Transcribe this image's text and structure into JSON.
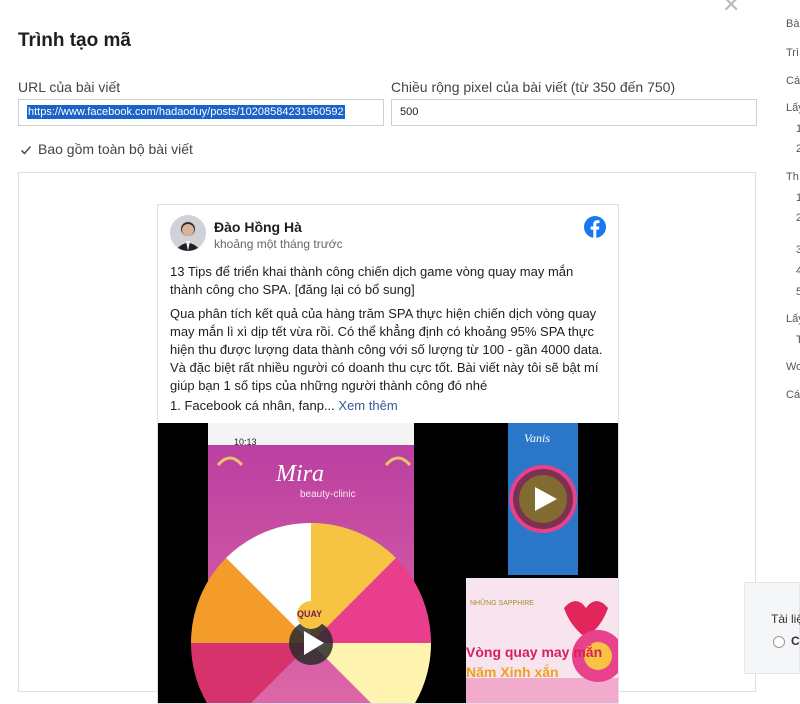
{
  "dialog": {
    "title": "Trình tạo mã",
    "url_label": "URL của bài viết",
    "url_value": "https://www.facebook.com/hadaoduy/posts/10208584231960592",
    "width_label": "Chiều rộng pixel của bài viết (từ 350 đến 750)",
    "width_value": "500",
    "include_label": "Bao gồm toàn bộ bài viết",
    "include_checked": true
  },
  "post": {
    "author": "Đào Hồng Hà",
    "time": "khoảng một tháng trước",
    "headline": "13 Tips để triển khai thành công chiến dịch game vòng quay may mắn thành công cho SPA. [đăng lại có bổ sung]",
    "body": "Qua phân tích kết quả của hàng trăm SPA thực hiện chiến dịch vòng quay may mắn lì xì dịp tết vừa rồi. Có thể khẳng định có khoảng 95% SPA thực hiện thu được lượng data thành công với số lượng từ 100 - gần 4000 data. Và đặc biệt rất nhiều người có doanh thu cực tốt. Bài viết này tôi sẽ bật mí giúp bạn 1 số tips của những người thành công đó nhé",
    "snippet": "1. Facebook cá nhân, fanp...",
    "see_more": "Xem thêm",
    "media": {
      "phone_time": "10:13",
      "brand_name": "Mira",
      "brand_sub": "beauty-clinic",
      "wheel_center": "QUAY",
      "thumb1_title": "Vanis",
      "thumb2_brand": "NHỮNG SAPPHIRE",
      "thumb2_text1": "Vòng quay may mắn",
      "thumb2_text2": "Năm Xinh xắn"
    }
  },
  "sidebar": {
    "items": [
      "Bà",
      "Trì",
      "Cá",
      "Lấy",
      "1",
      "2",
      "Th",
      "1",
      "2",
      "3",
      "4",
      "5",
      "Lấy",
      "T",
      "Wo",
      "Cá"
    ]
  },
  "bottom_card": {
    "label": "Tài liệ",
    "option": "C"
  },
  "colors": {
    "facebook_blue": "#1877f2",
    "link": "#385898",
    "selection": "#1a63c9"
  }
}
